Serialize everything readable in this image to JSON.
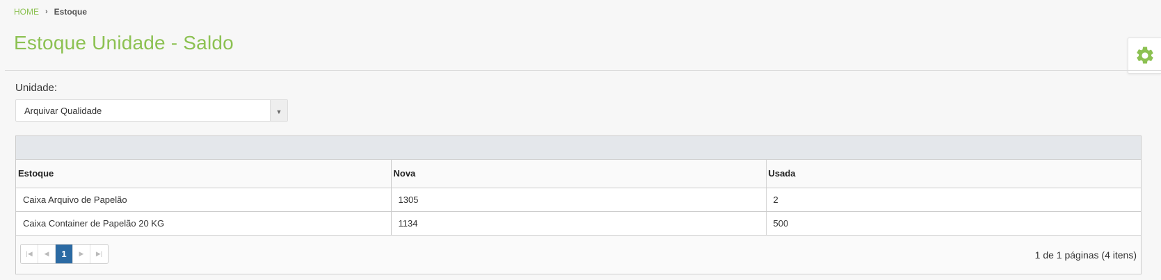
{
  "breadcrumb": {
    "home": "HOME",
    "separator": "›",
    "current": "Estoque"
  },
  "page_title": "Estoque Unidade - Saldo",
  "filter": {
    "label": "Unidade:",
    "selected": "Arquivar Qualidade",
    "arrow": "▼"
  },
  "table": {
    "headers": [
      "Estoque",
      "Nova",
      "Usada"
    ],
    "rows": [
      [
        "Caixa Arquivo de Papelão",
        "1305",
        "2"
      ],
      [
        "Caixa Container de Papelão 20 KG",
        "1134",
        "500"
      ]
    ]
  },
  "pager": {
    "first": "|◀",
    "prev": "◀",
    "current_page": "1",
    "next": "▶",
    "last": "▶|",
    "info": "1 de 1 páginas (4 itens)"
  },
  "colors": {
    "accent": "#8cc152",
    "page_active": "#2b6aa3"
  },
  "icons": {
    "settings": "gear-icon"
  }
}
